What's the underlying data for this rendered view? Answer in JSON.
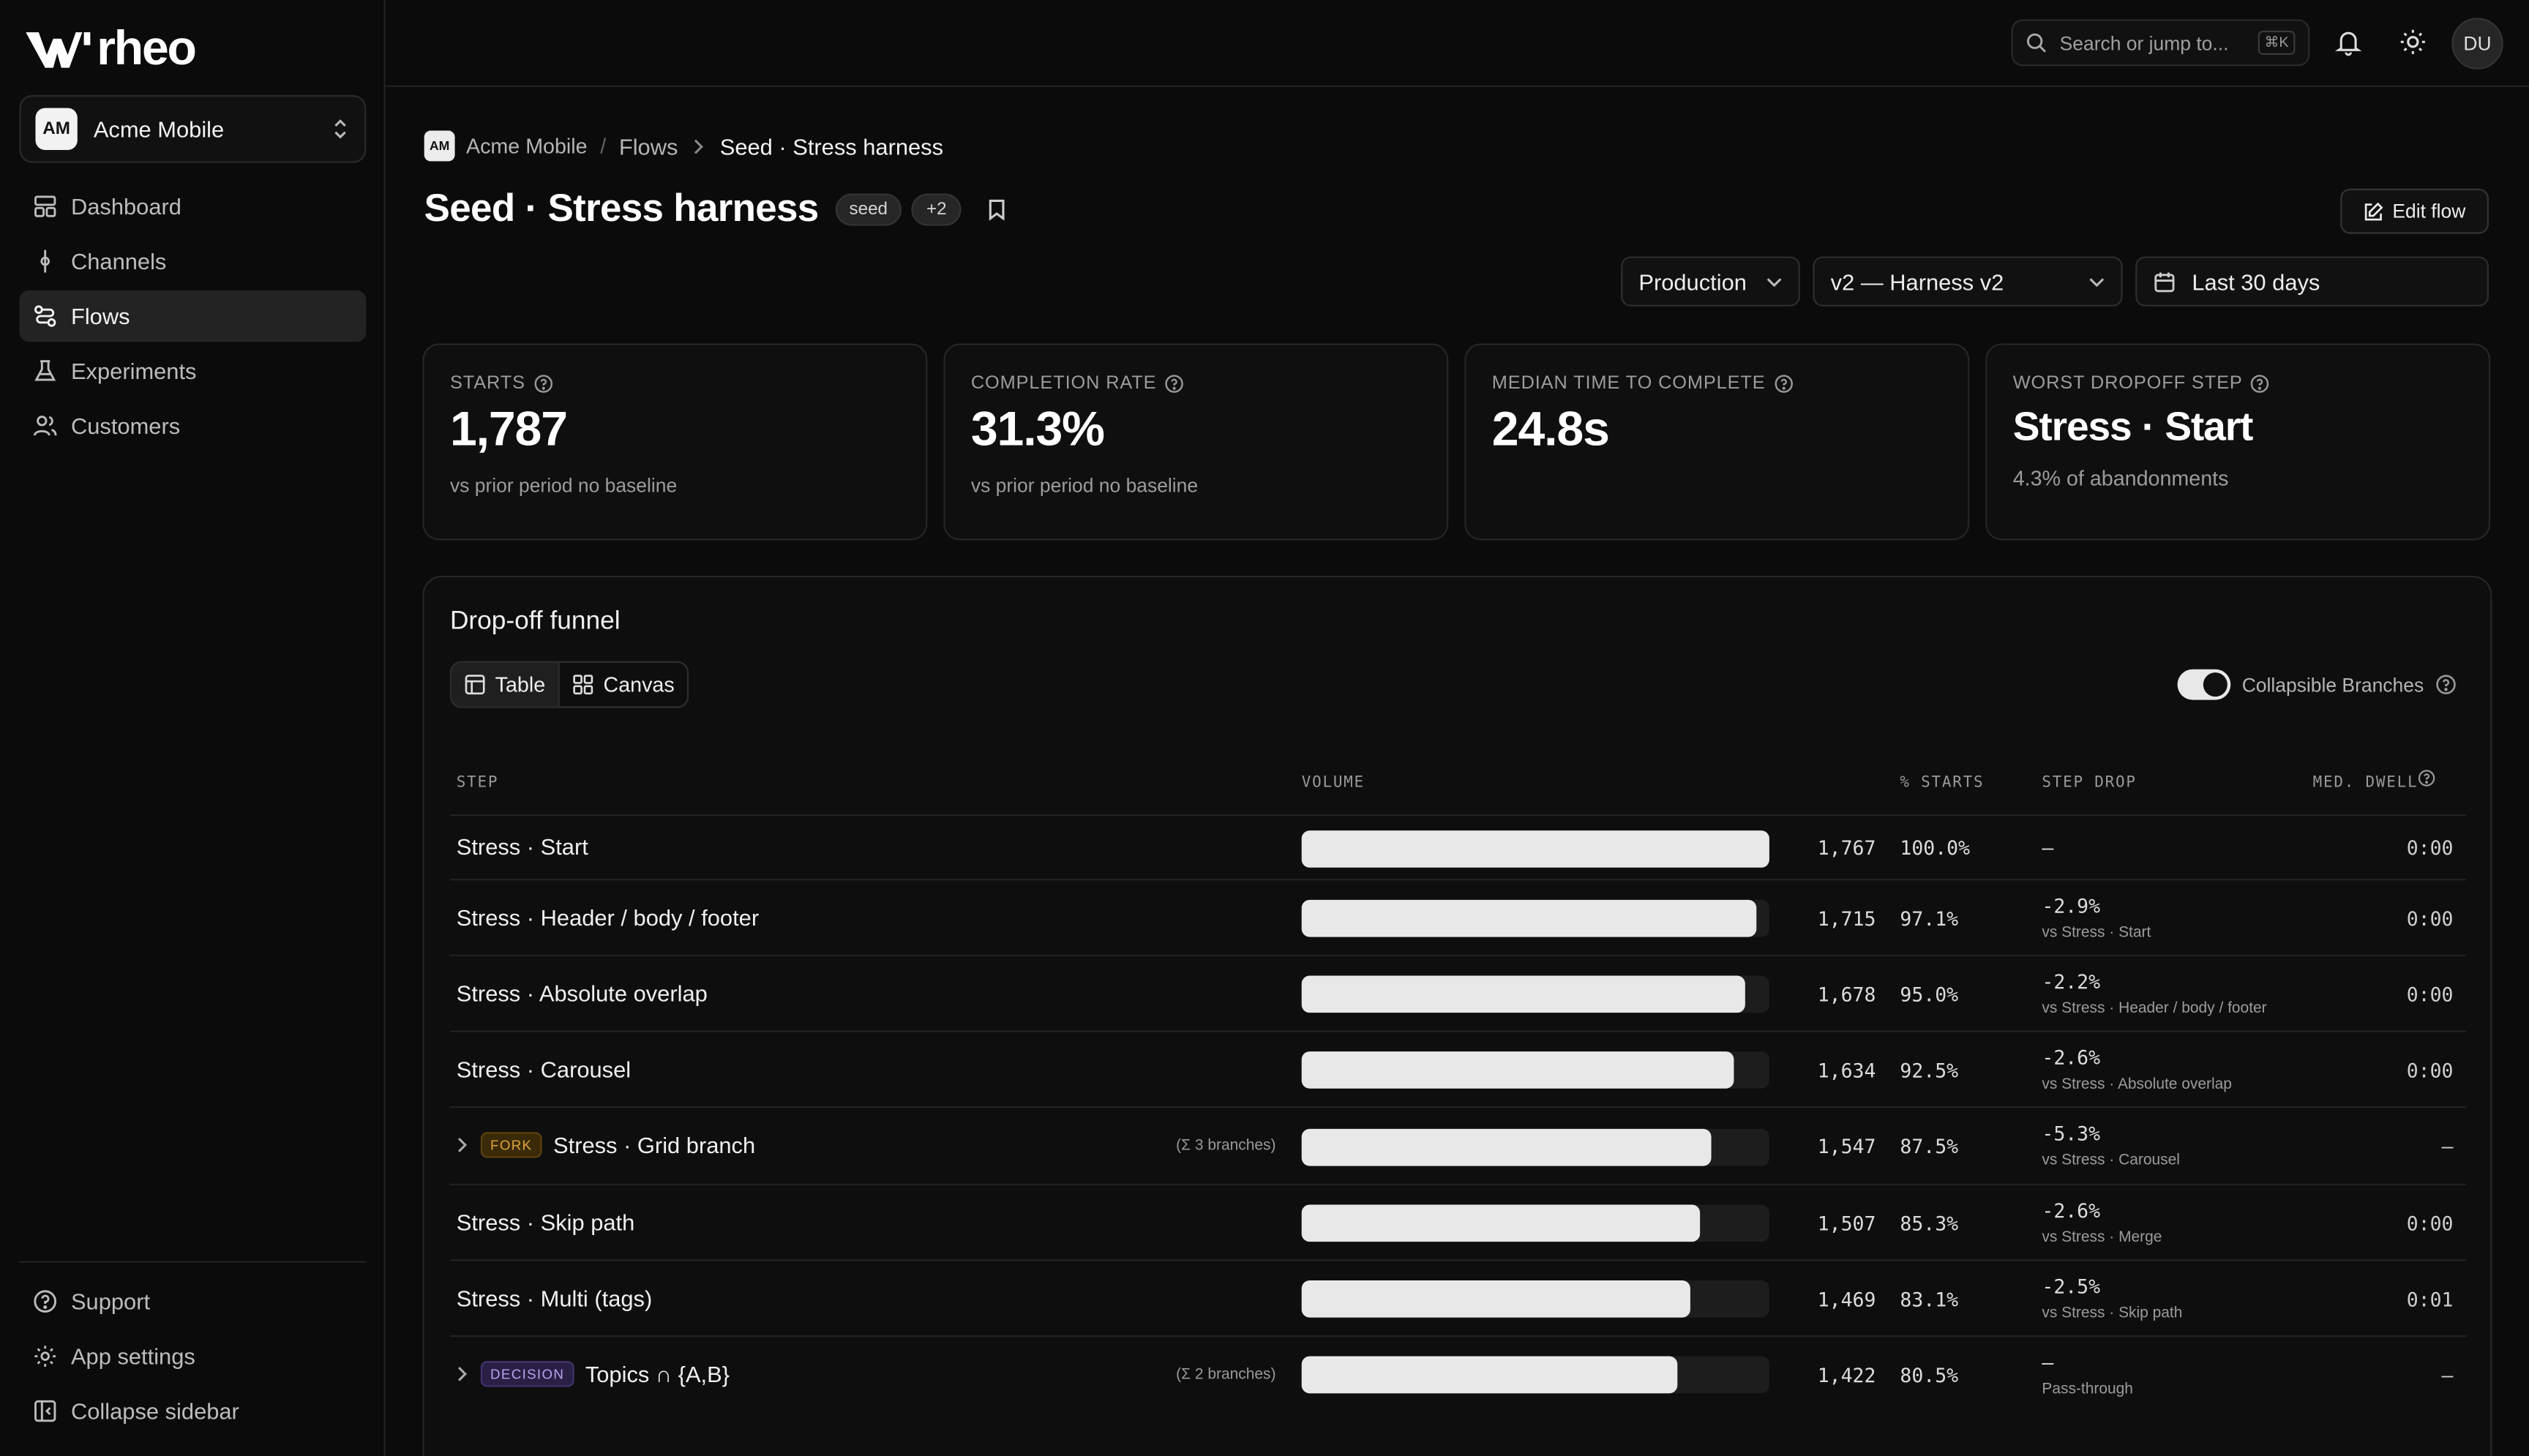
{
  "app": {
    "brand": "rheo"
  },
  "workspace": {
    "initials": "AM",
    "name": "Acme Mobile"
  },
  "nav": {
    "items": [
      {
        "label": "Dashboard",
        "icon": "dashboard-icon"
      },
      {
        "label": "Channels",
        "icon": "channels-icon"
      },
      {
        "label": "Flows",
        "icon": "flows-icon",
        "active": true
      },
      {
        "label": "Experiments",
        "icon": "flask-icon"
      },
      {
        "label": "Customers",
        "icon": "users-icon"
      }
    ],
    "bottom": [
      {
        "label": "Support",
        "icon": "help-icon"
      },
      {
        "label": "App settings",
        "icon": "gear-icon"
      },
      {
        "label": "Collapse sidebar",
        "icon": "collapse-icon"
      }
    ]
  },
  "topbar": {
    "search_placeholder": "Search or jump to...",
    "search_shortcut": "⌘K",
    "user_initials": "DU"
  },
  "breadcrumb": {
    "workspace_initials": "AM",
    "workspace": "Acme Mobile",
    "section": "Flows",
    "current": "Seed · Stress harness"
  },
  "page": {
    "title": "Seed · Stress harness",
    "tag": "seed",
    "more_tags": "+2",
    "edit_label": "Edit flow"
  },
  "filters": {
    "environment": "Production",
    "version": "v2 — Harness v2",
    "range": "Last 30 days"
  },
  "kpis": [
    {
      "label": "STARTS",
      "value": "1,787",
      "sub": "vs prior period no baseline"
    },
    {
      "label": "COMPLETION RATE",
      "value": "31.3%",
      "sub": "vs prior period no baseline"
    },
    {
      "label": "MEDIAN TIME TO COMPLETE",
      "value": "24.8s",
      "sub": ""
    },
    {
      "label": "WORST DROPOFF STEP",
      "value": "Stress · Start",
      "sub": "4.3% of abandonments"
    }
  ],
  "funnel": {
    "title": "Drop-off funnel",
    "views": [
      "Table",
      "Canvas"
    ],
    "toggle_label": "Collapsible Branches",
    "toggle_on": true,
    "columns": {
      "step": "STEP",
      "volume": "VOLUME",
      "pct": "% STARTS",
      "drop": "STEP DROP",
      "dwell": "MED. DWELL"
    },
    "rows": [
      {
        "name": "Stress · Start",
        "volume": "1,767",
        "volume_value": 1767,
        "pct": "100.0%",
        "drop": "–",
        "drop_sub": "",
        "dwell": "0:00",
        "tag": "",
        "branches": ""
      },
      {
        "name": "Stress · Header / body / footer",
        "volume": "1,715",
        "volume_value": 1715,
        "pct": "97.1%",
        "drop": "-2.9%",
        "drop_sub": "vs Stress · Start",
        "dwell": "0:00",
        "tag": "",
        "branches": ""
      },
      {
        "name": "Stress · Absolute overlap",
        "volume": "1,678",
        "volume_value": 1678,
        "pct": "95.0%",
        "drop": "-2.2%",
        "drop_sub": "vs Stress · Header / body / footer",
        "dwell": "0:00",
        "tag": "",
        "branches": ""
      },
      {
        "name": "Stress · Carousel",
        "volume": "1,634",
        "volume_value": 1634,
        "pct": "92.5%",
        "drop": "-2.6%",
        "drop_sub": "vs Stress · Absolute overlap",
        "dwell": "0:00",
        "tag": "",
        "branches": ""
      },
      {
        "name": "Stress · Grid branch",
        "volume": "1,547",
        "volume_value": 1547,
        "pct": "87.5%",
        "drop": "-5.3%",
        "drop_sub": "vs Stress · Carousel",
        "dwell": "–",
        "tag": "FORK",
        "branches": "(Σ 3 branches)"
      },
      {
        "name": "Stress · Skip path",
        "volume": "1,507",
        "volume_value": 1507,
        "pct": "85.3%",
        "drop": "-2.6%",
        "drop_sub": "vs Stress · Merge",
        "dwell": "0:00",
        "tag": "",
        "branches": ""
      },
      {
        "name": "Stress · Multi (tags)",
        "volume": "1,469",
        "volume_value": 1469,
        "pct": "83.1%",
        "drop": "-2.5%",
        "drop_sub": "vs Stress · Skip path",
        "dwell": "0:01",
        "tag": "",
        "branches": ""
      },
      {
        "name": "Topics ∩ {A,B}",
        "volume": "1,422",
        "volume_value": 1422,
        "pct": "80.5%",
        "drop": "–",
        "drop_sub": "Pass-through",
        "dwell": "–",
        "tag": "DECISION",
        "branches": "(Σ 2 branches)"
      }
    ]
  }
}
